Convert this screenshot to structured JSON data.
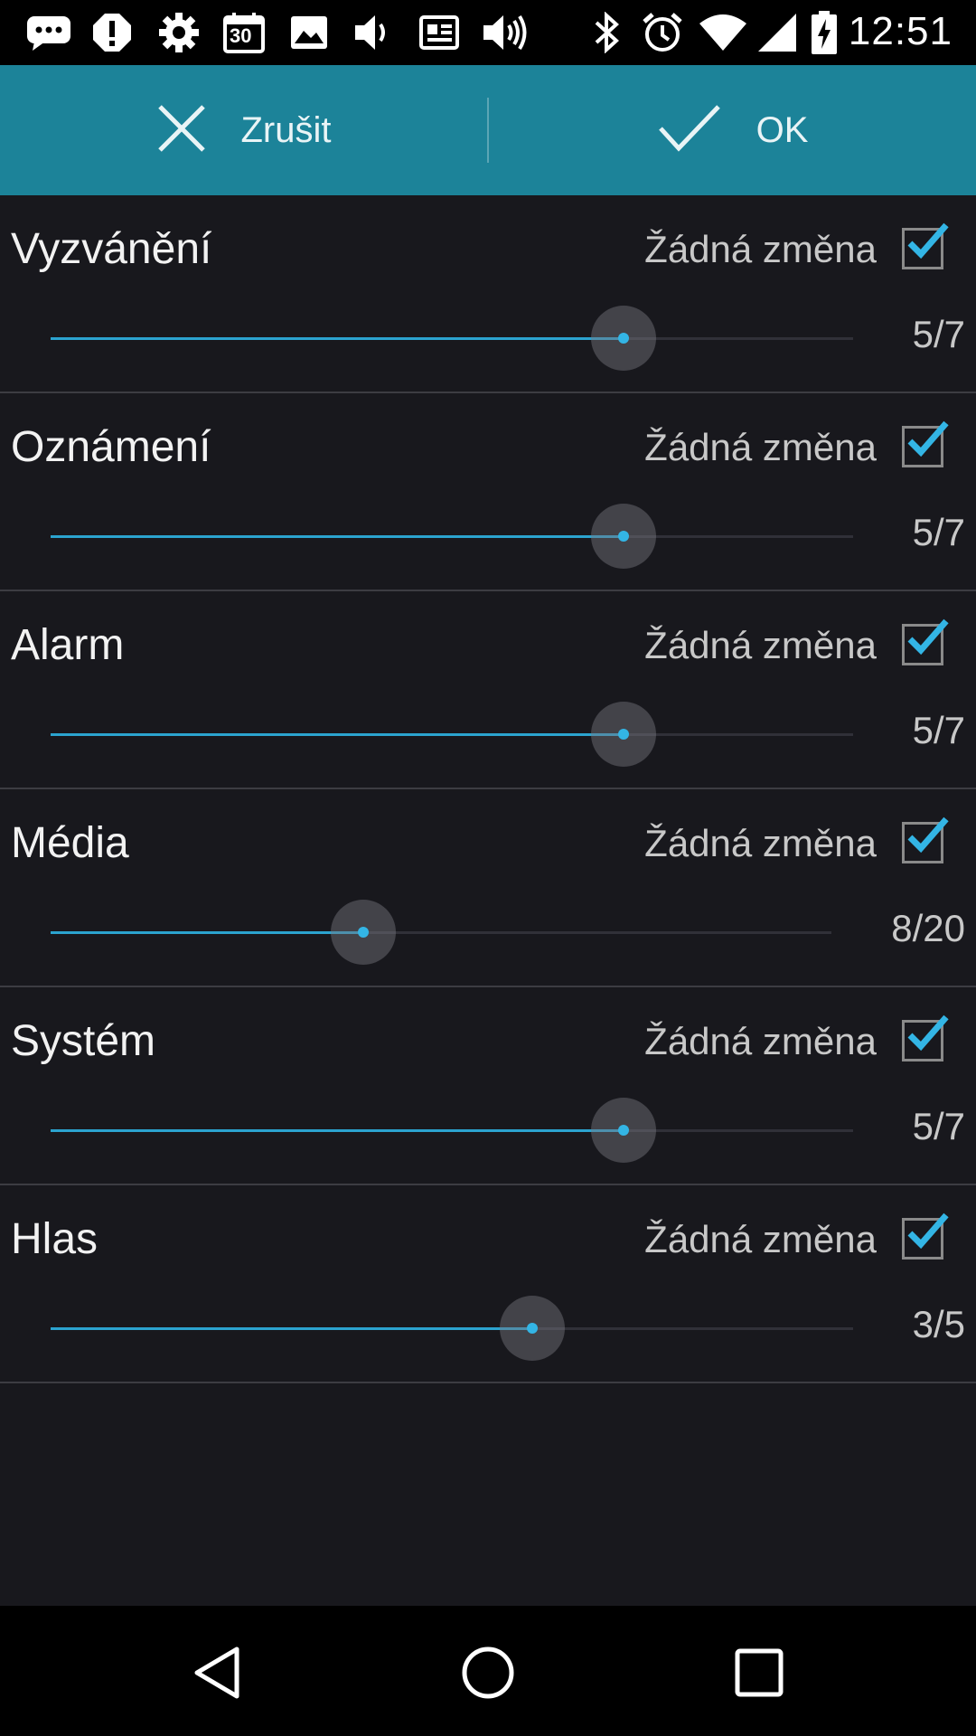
{
  "status_bar": {
    "time": "12:51",
    "icons": [
      "chat-icon",
      "alert-icon",
      "gear-icon",
      "calendar-icon",
      "image-icon",
      "volume-icon",
      "news-icon",
      "volume-up-icon",
      "bluetooth-icon",
      "alarm-icon",
      "wifi-icon",
      "signal-icon",
      "battery-charging-icon"
    ],
    "calendar_day": "30"
  },
  "action_bar": {
    "cancel_label": "Zrušit",
    "ok_label": "OK",
    "background": "#1c8399"
  },
  "rows": [
    {
      "title": "Vyzvánění",
      "status": "Žádná změna",
      "checked": true,
      "value": "5/7",
      "level": 5,
      "max": 7
    },
    {
      "title": "Oznámení",
      "status": "Žádná změna",
      "checked": true,
      "value": "5/7",
      "level": 5,
      "max": 7
    },
    {
      "title": "Alarm",
      "status": "Žádná změna",
      "checked": true,
      "value": "5/7",
      "level": 5,
      "max": 7
    },
    {
      "title": "Média",
      "status": "Žádná změna",
      "checked": true,
      "value": "8/20",
      "level": 8,
      "max": 20
    },
    {
      "title": "Systém",
      "status": "Žádná změna",
      "checked": true,
      "value": "5/7",
      "level": 5,
      "max": 7
    },
    {
      "title": "Hlas",
      "status": "Žádná změna",
      "checked": true,
      "value": "3/5",
      "level": 3,
      "max": 5
    }
  ],
  "colors": {
    "accent": "#33b5e5",
    "background": "#18181d",
    "divider": "#3c3c42"
  },
  "nav_bar": {
    "icons": [
      "back-icon",
      "home-icon",
      "recents-icon"
    ]
  }
}
